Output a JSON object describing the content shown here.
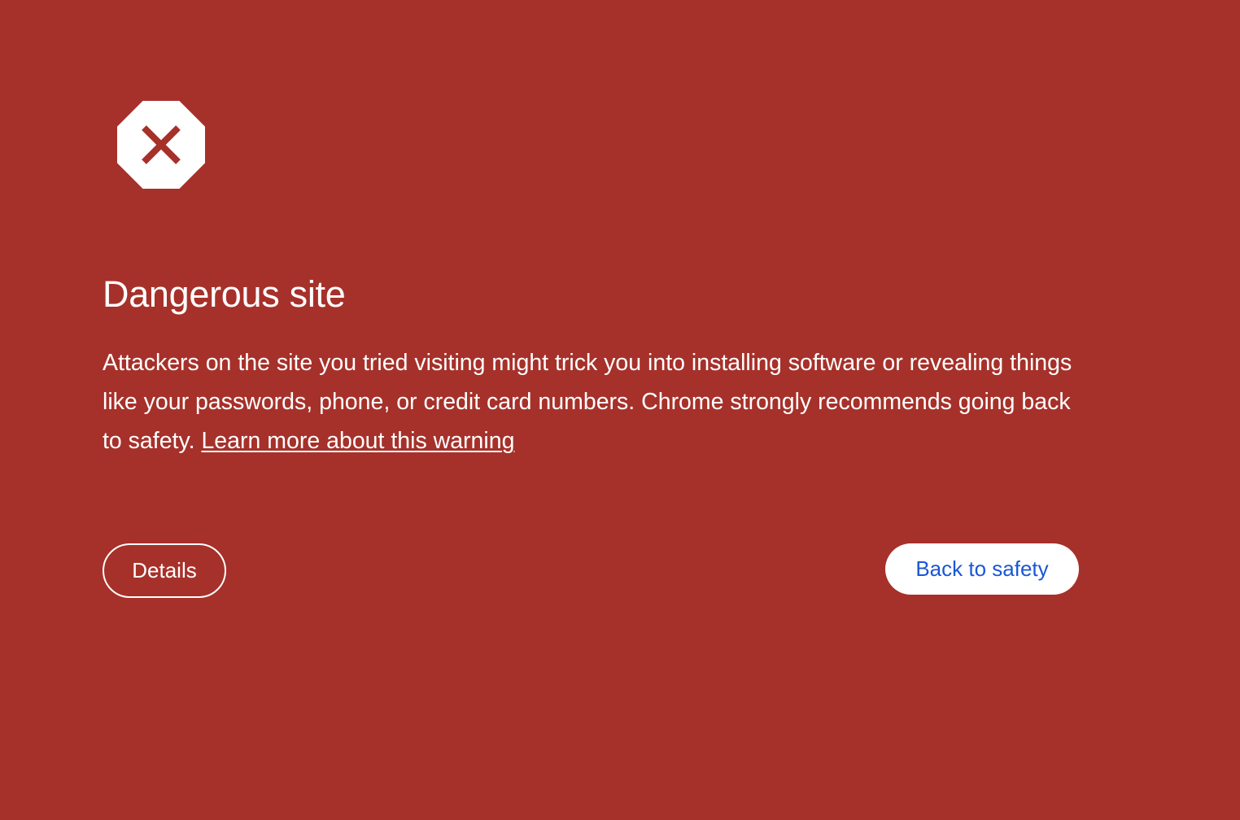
{
  "interstitial": {
    "icon": "stop-octagon-x-icon",
    "title": "Dangerous site",
    "body_text": "Attackers on the site you tried visiting might trick you into installing software or revealing things like your passwords, phone, or credit card numbers. Chrome strongly recommends going back to safety.",
    "learn_more_link": "Learn more about this warning",
    "details_button": "Details",
    "back_to_safety_button": "Back to safety"
  },
  "colors": {
    "background": "#a6312a",
    "text": "#ffffff",
    "primary_button_bg": "#ffffff",
    "primary_button_text": "#1a56d6"
  }
}
